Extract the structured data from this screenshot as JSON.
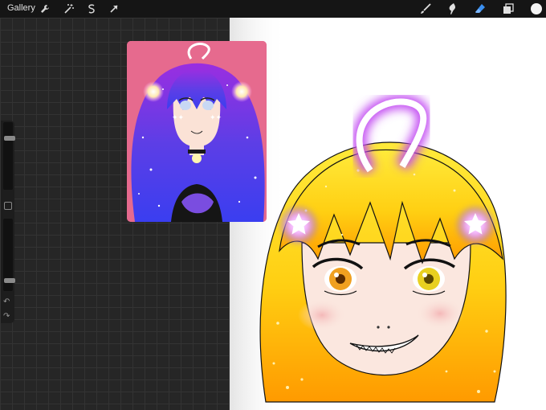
{
  "topbar": {
    "gallery_label": "Gallery",
    "left_tools": [
      "wrench-icon",
      "magic-wand-icon",
      "selection-icon",
      "transform-arrow-icon"
    ],
    "right_tools": [
      "brush-icon",
      "smudge-icon",
      "eraser-icon",
      "layers-icon",
      "color-swatch"
    ]
  },
  "colors": {
    "toolbar": "#151515",
    "active_tool": "#3a8ff0",
    "canvas_bg": "#262626",
    "reference_bg": "#e66a8e",
    "hair_ref": "#6a3ce0",
    "hair_main": "#ffcf12",
    "glow": "#d25cf0"
  },
  "sidebar": {
    "brush_size_level": 0.78,
    "opacity_level": 0.12
  }
}
